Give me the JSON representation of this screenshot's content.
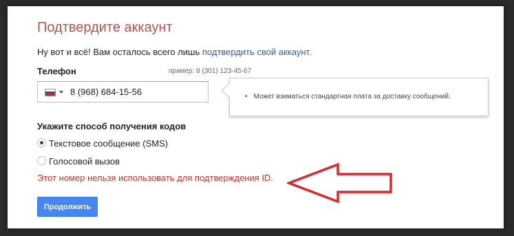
{
  "page": {
    "title": "Подтвердите аккаунт",
    "intro_text": "Ну вот и всё! Вам осталось всего лишь",
    "intro_link": "подтвердить свой аккаунт",
    "intro_end": "."
  },
  "phone": {
    "label": "Телефон",
    "example": "пример: 8 (301) 123-45-67",
    "value": "8 (968) 684-15-56",
    "country_flag": "russia-flag",
    "tooltip": "Может взиматься стандартная плата за доставку сообщений."
  },
  "methods": {
    "label": "Укажите способ получения кодов",
    "options": [
      {
        "label": "Текстовое сообщение (SMS)",
        "checked": true
      },
      {
        "label": "Голосовой вызов",
        "checked": false
      }
    ]
  },
  "error": {
    "text": "Этот номер нельзя использовать для подтверждения ID."
  },
  "actions": {
    "continue_label": "Продолжить"
  },
  "colors": {
    "title": "#b8524f",
    "link": "#2a5db0",
    "error": "#c5322b",
    "button": "#4787ed",
    "annotation_arrow": "#e0262a"
  }
}
